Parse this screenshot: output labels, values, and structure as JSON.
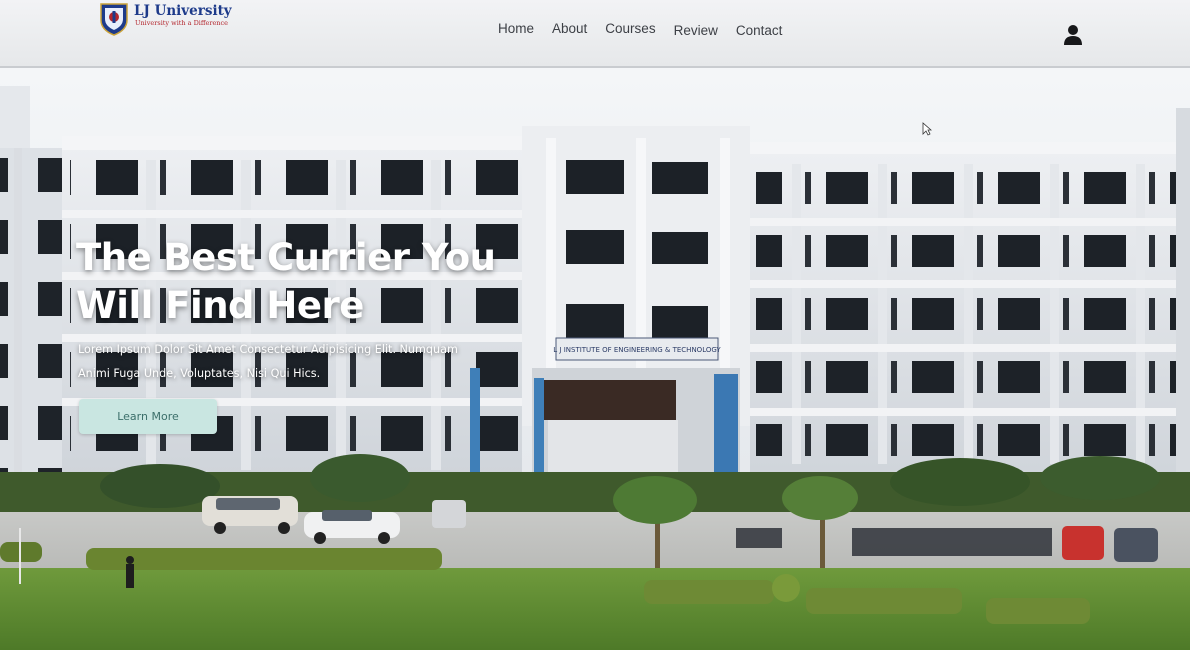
{
  "brand": {
    "name": "LJ University",
    "tagline": "University with a Difference"
  },
  "nav": {
    "items": [
      {
        "label": "Home"
      },
      {
        "label": "About"
      },
      {
        "label": "Courses"
      },
      {
        "label": "Review"
      },
      {
        "label": "Contact"
      }
    ],
    "user_icon": "user-icon"
  },
  "hero": {
    "title": "The Best Currier You Will Find Here",
    "description": "Lorem Ipsum Dolor Sit Amet Consectetur Adipisicing Elit. Numquam Animi Fuga Unde, Voluptates, Nisi Qui Hics.",
    "button_label": "Learn More",
    "building_sign": "L J INSTITUTE OF ENGINEERING & TECHNOLOGY"
  },
  "colors": {
    "brand_blue": "#1d3a8a",
    "brand_red": "#b3262d",
    "button_bg": "#c9e6e1",
    "button_text": "#3c6f6a"
  }
}
